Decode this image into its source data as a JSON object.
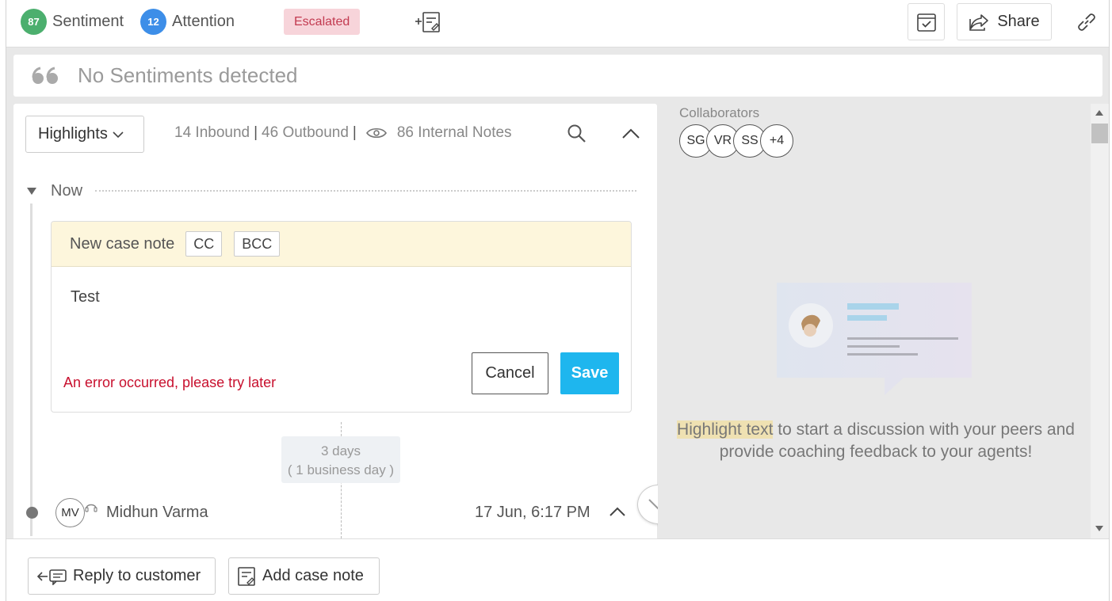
{
  "header": {
    "sentiment_score": "87",
    "sentiment_label": "Sentiment",
    "sentiment_color": "#4caf6e",
    "attention_score": "12",
    "attention_label": "Attention",
    "attention_color": "#3d8ee8",
    "status_badge": "Escalated",
    "share_label": "Share"
  },
  "sentiment_bar": {
    "text": "No Sentiments detected"
  },
  "conversation": {
    "filter_label": "Highlights",
    "inbound": "14 Inbound",
    "outbound": "46 Outbound",
    "internal_notes": "86 Internal Notes",
    "now_label": "Now",
    "note": {
      "title": "New case note",
      "cc_label": "CC",
      "bcc_label": "BCC",
      "body": "Test",
      "error": "An error occurred, please try later",
      "cancel_label": "Cancel",
      "save_label": "Save"
    },
    "gap": {
      "days": "3 days",
      "business": "( 1 business day )"
    },
    "message": {
      "initials": "MV",
      "author": "Midhun Varma",
      "time": "17 Jun, 6:17 PM"
    }
  },
  "collaboration": {
    "label": "Collaborators",
    "avatars": [
      "SG",
      "VR",
      "SS",
      "+4"
    ],
    "hint_highlight": "Highlight text",
    "hint_rest": " to start a discussion with your peers and provide coaching feedback to your agents!"
  },
  "footer": {
    "reply_label": "Reply to customer",
    "add_note_label": "Add case note"
  },
  "icons": {
    "add_note": "note-add-icon",
    "save_case": "checklist-icon",
    "share": "share-icon",
    "link": "link-icon",
    "quote": "quote-icon",
    "eye": "eye-icon",
    "search": "search-icon"
  },
  "colors": {
    "accent": "#1eb6ee",
    "error": "#c8102e",
    "escalated_bg": "#f7d4da",
    "note_header_bg": "#fdf6dc"
  }
}
